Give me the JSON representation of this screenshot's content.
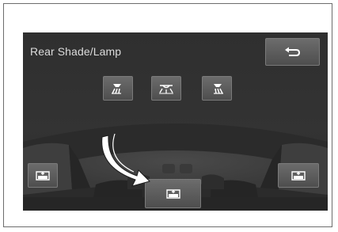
{
  "screen": {
    "title": "Rear Shade/Lamp"
  },
  "buttons": {
    "back": {
      "icon": "back-arrow-icon"
    },
    "lamps": [
      {
        "name": "left-lamp",
        "icon": "lamp-left-icon"
      },
      {
        "name": "center-lamp",
        "icon": "lamp-center-icon"
      },
      {
        "name": "right-lamp",
        "icon": "lamp-right-icon"
      }
    ],
    "shades": [
      {
        "name": "left-side-shade",
        "icon": "shade-icon"
      },
      {
        "name": "right-side-shade",
        "icon": "shade-icon"
      },
      {
        "name": "rear-window-shade",
        "icon": "shade-icon",
        "highlighted_by_arrow": true
      }
    ]
  },
  "colors": {
    "screen_bg": "#303030",
    "button_face": "#5e5e5e",
    "text": "#dcdcdc",
    "icon": "#ffffff"
  }
}
